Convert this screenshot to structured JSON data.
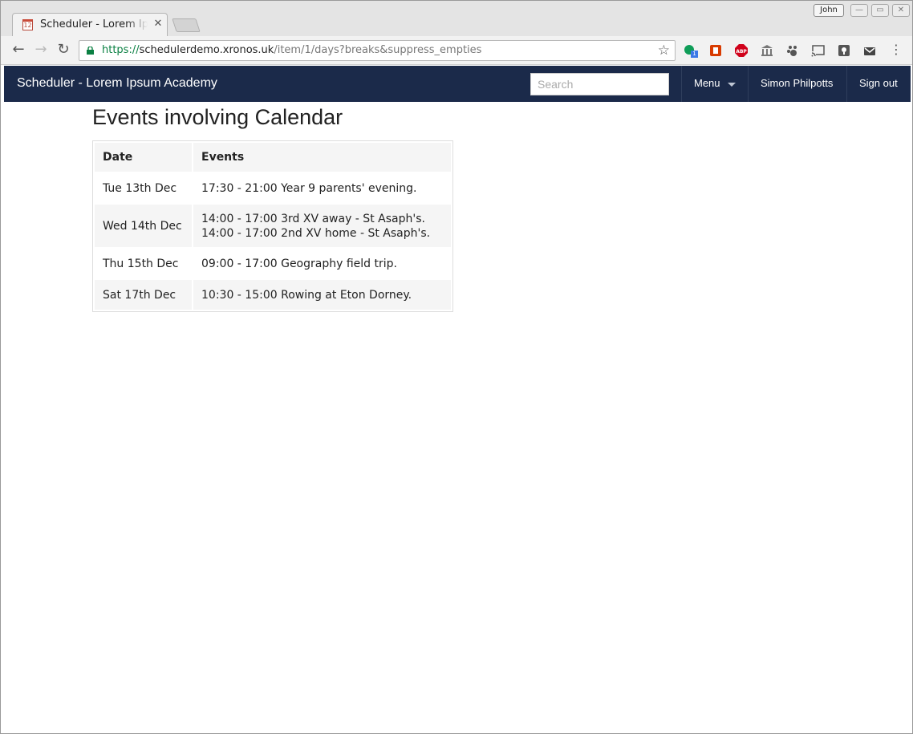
{
  "browser": {
    "tab_title": "Scheduler - Lorem Ipsum Academy",
    "tab_favicon_text": "12",
    "profile_name": "John",
    "url_scheme": "https://",
    "url_host": "schedulerdemo.xronos.uk",
    "url_path": "/item/1/days?breaks&suppress_empties",
    "extension_badge": "1",
    "extensions": [
      "hangouts-icon",
      "office-icon",
      "adblock-icon",
      "museum-icon",
      "paw-icon",
      "cast-icon",
      "keep-icon",
      "mail-icon"
    ]
  },
  "navbar": {
    "brand": "Scheduler - Lorem Ipsum Academy",
    "search_placeholder": "Search",
    "menu_label": "Menu",
    "user_name": "Simon Philpotts",
    "signout_label": "Sign out"
  },
  "page": {
    "title": "Events involving Calendar",
    "table": {
      "headers": {
        "date": "Date",
        "events": "Events"
      },
      "rows": [
        {
          "date": "Tue 13th Dec",
          "events": [
            "17:30 - 21:00 Year 9 parents' evening."
          ]
        },
        {
          "date": "Wed 14th Dec",
          "events": [
            "14:00 - 17:00 3rd XV away - St Asaph's.",
            "14:00 - 17:00 2nd XV home - St Asaph's."
          ]
        },
        {
          "date": "Thu 15th Dec",
          "events": [
            "09:00 - 17:00 Geography field trip."
          ]
        },
        {
          "date": "Sat 17th Dec",
          "events": [
            "10:30 - 15:00 Rowing at Eton Dorney."
          ]
        }
      ]
    }
  },
  "colors": {
    "navbar_bg": "#1b2a4a",
    "url_scheme": "#0b8043",
    "table_stripe": "#f5f5f5"
  }
}
